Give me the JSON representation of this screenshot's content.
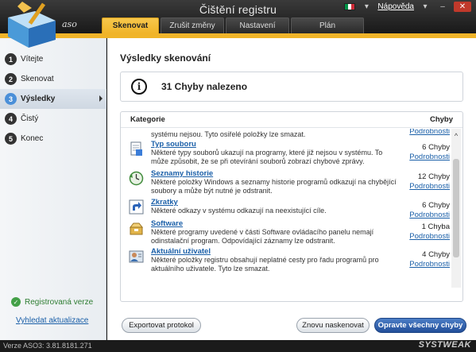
{
  "app": {
    "title": "Čištění registru",
    "logo_text": "aso",
    "help_label": "Nápověda",
    "minimize_glyph": "–",
    "close_glyph": "✕"
  },
  "tabs": [
    {
      "label": "Skenovat",
      "active": true
    },
    {
      "label": "Zrušit změny",
      "active": false
    },
    {
      "label": "Nastavení",
      "active": false
    },
    {
      "label": "Plán",
      "active": false
    }
  ],
  "sidebar": {
    "steps": [
      {
        "num": "1",
        "label": "Vítejte"
      },
      {
        "num": "2",
        "label": "Skenovat"
      },
      {
        "num": "3",
        "label": "Výsledky",
        "active": true
      },
      {
        "num": "4",
        "label": "Čistý"
      },
      {
        "num": "5",
        "label": "Konec"
      }
    ],
    "status": "Registrovaná verze",
    "update_link": "Vyhledat aktualizace"
  },
  "main": {
    "heading": "Výsledky skenování",
    "summary": "31 Chyby nalezeno",
    "columns": {
      "category": "Kategorie",
      "errors": "Chyby"
    },
    "rows": [
      {
        "icon": "partial-row",
        "title": "",
        "desc": "systému nejsou. Tyto osiřelé položky lze smazat.",
        "count": "",
        "details": "Podrobnosti"
      },
      {
        "icon": "file-icon",
        "title": "Typ souboru",
        "desc": "Některé typy souborů ukazují na programy, které již nejsou v systému. To může způsobit, že se při otevírání souborů zobrazí chybové zprávy.",
        "count": "6 Chyby",
        "details": "Podrobnosti"
      },
      {
        "icon": "history-icon",
        "title": "Seznamy historie",
        "desc": "Některé položky Windows a seznamy historie programů odkazují na chybějící soubory a může být nutné je odstranit.",
        "count": "12 Chyby",
        "details": "Podrobnosti"
      },
      {
        "icon": "shortcut-icon",
        "title": "Zkratky",
        "desc": "Některé odkazy v systému odkazují na neexistující cíle.",
        "count": "6 Chyby",
        "details": "Podrobnosti"
      },
      {
        "icon": "software-icon",
        "title": "Software",
        "desc": "Některé programy uvedené v části Software ovládacího panelu nemají odinstalační program. Odpovídající záznamy lze odstranit.",
        "count": "1 Chyba",
        "details": "Podrobnosti"
      },
      {
        "icon": "user-icon",
        "title": "Aktuální uživatel",
        "desc": "Některé položky registru obsahují neplatné cesty pro řadu programů pro aktuálního uživatele. Tyto lze smazat.",
        "count": "4 Chyby",
        "details": "Podrobnosti"
      }
    ],
    "buttons": {
      "export": "Exportovat protokol",
      "rescan": "Znovu naskenovat",
      "fix": "Opravte všechny chyby"
    }
  },
  "footer": {
    "version": "Verze ASO3: 3.81.8181.271",
    "brand": "SYSTWEAK"
  },
  "colors": {
    "accent_tab": "#f0b429",
    "link": "#1a5fa8",
    "primary_button": "#234f9a",
    "registered_green": "#2e7d32"
  }
}
